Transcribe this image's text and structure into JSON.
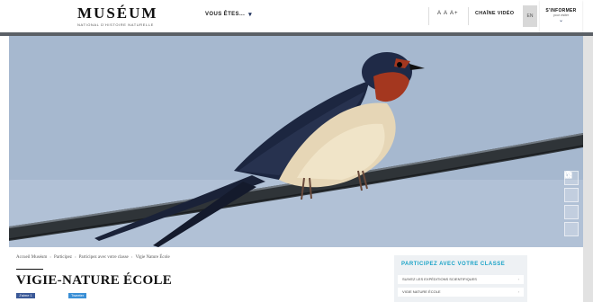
{
  "header": {
    "logo_word": "MUSÉUM",
    "logo_sub": "national d'histoire naturelle",
    "vous_label": "VOUS ÊTES...",
    "font_size_label": "A A A+",
    "chaine_label": "CHAÎNE VIDÉO",
    "en_label": "EN",
    "visiter_title": "S'INFORMER",
    "visiter_sub": "pour visiter",
    "visiter_chevron": "⌄"
  },
  "hero": {
    "tools": [
      "search-icon",
      "calendar-icon",
      "ticket-icon",
      "info-icon"
    ]
  },
  "breadcrumb": [
    "Accueil Muséum",
    "Participez",
    "Participez avec votre classe",
    "Vigie Nature École"
  ],
  "page": {
    "title": "VIGIE-NATURE ÉCOLE",
    "share_fb": "J'aime 1",
    "share_tw": "Tweeter"
  },
  "side_panel": {
    "heading": "PARTICIPEZ AVEC VOTRE CLASSE",
    "items": [
      "SUIVEZ LES EXPÉDITIONS SCIENTIFIQUES",
      "VIGIE NATURE ÉCOLE"
    ]
  },
  "colors": {
    "accent": "#1aa3c7",
    "navy": "#1c2f5a",
    "sky": "#a9bbd1"
  }
}
